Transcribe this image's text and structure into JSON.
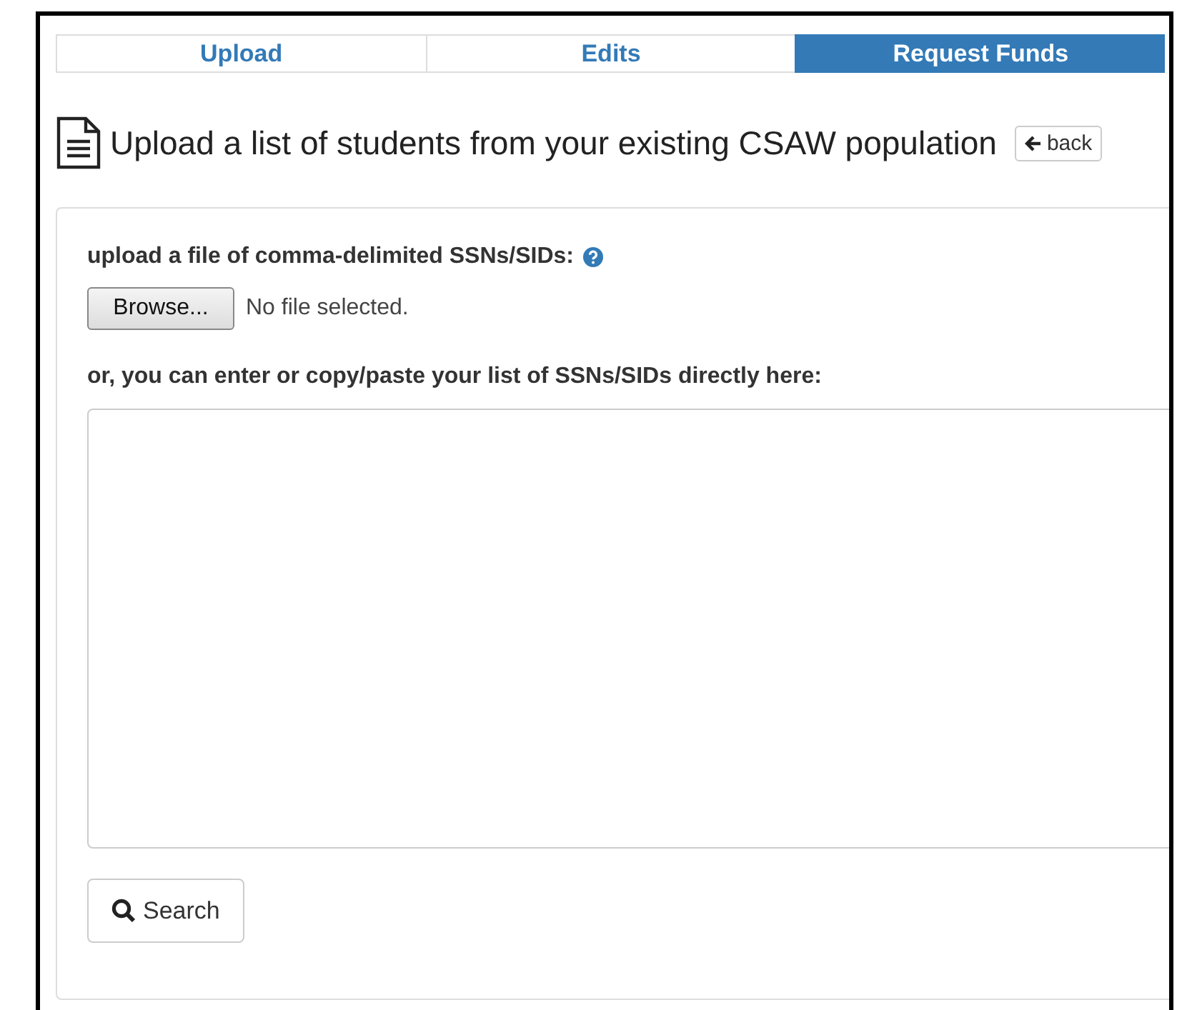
{
  "tabs": [
    {
      "label": "Upload",
      "selected": false
    },
    {
      "label": "Edits",
      "selected": false
    },
    {
      "label": "Request Funds",
      "selected": true
    }
  ],
  "heading": {
    "title": "Upload a list of students from your existing CSAW population",
    "back_button": "back"
  },
  "form": {
    "upload_label": "upload a file of comma-delimited SSNs/SIDs:",
    "browse_button": "Browse...",
    "file_status": "No file selected.",
    "paste_label": "or, you can enter or copy/paste your list of SSNs/SIDs directly here:",
    "search_button": "Search"
  }
}
